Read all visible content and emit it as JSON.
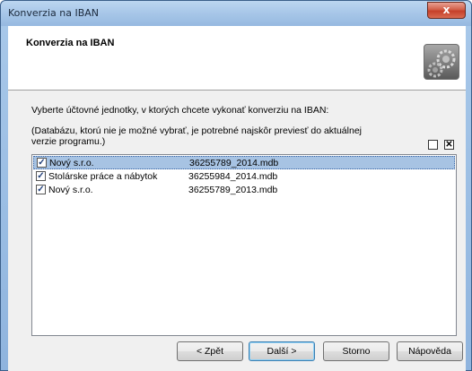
{
  "window": {
    "title": "Konverzia na IBAN",
    "close_glyph": "x"
  },
  "header": {
    "title": "Konverzia na IBAN",
    "icon": "gears-icon"
  },
  "instruction": "Vyberte účtovné jednotky, v ktorých chcete vykonať konverziu na IBAN:",
  "note_line1": "(Databázu, ktorú nie je možné vybrať, je potrebné najskôr previesť do aktuálnej",
  "note_line2": "verzie programu.)",
  "header_checkboxes": {
    "uncheck_all": "",
    "check_all": "✕"
  },
  "list": {
    "rows": [
      {
        "name": "Nový s.r.o.",
        "file": "36255789_2014.mdb",
        "checked": true,
        "selected": true
      },
      {
        "name": "Stolárske práce a nábytok",
        "file": "36255984_2014.mdb",
        "checked": true,
        "selected": false
      },
      {
        "name": "Nový s.r.o.",
        "file": "36255789_2013.mdb",
        "checked": true,
        "selected": false
      }
    ],
    "check_glyph": "✓"
  },
  "buttons": {
    "back": "< Zpět",
    "next": "Další >",
    "cancel": "Storno",
    "help": "Nápověda"
  }
}
